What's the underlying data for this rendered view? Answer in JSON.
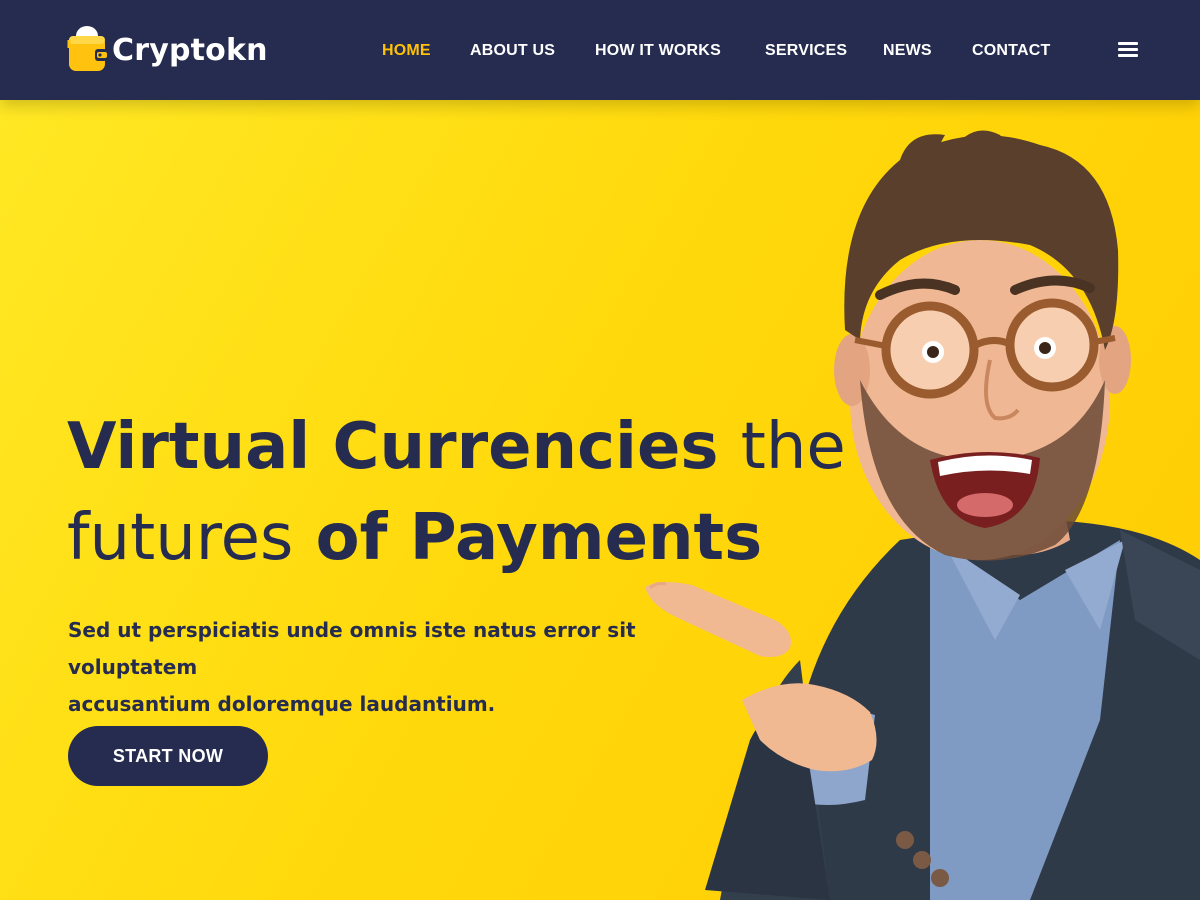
{
  "brand": {
    "name": "Cryptokn",
    "logo_icon": "wallet-coin-icon",
    "colors": {
      "primary": "#262c4f",
      "accent": "#ffc107",
      "hero_background": "#ffd80e"
    }
  },
  "nav": {
    "items": [
      {
        "label": "HOME",
        "active": true
      },
      {
        "label": "ABOUT US",
        "active": false
      },
      {
        "label": "HOW IT WORKS",
        "active": false
      },
      {
        "label": "SERVICES",
        "active": false
      },
      {
        "label": "NEWS",
        "active": false
      },
      {
        "label": "CONTACT",
        "active": false
      }
    ],
    "menu_icon": "hamburger-menu-icon"
  },
  "hero": {
    "headline": {
      "part1": "Virtual Currencies",
      "part2": "the",
      "part3": "futures",
      "part4": "of Payments"
    },
    "subtext_line1": "Sed ut perspiciatis unde omnis iste natus error sit voluptatem",
    "subtext_line2": "accusantium doloremque laudantium.",
    "cta_label": "START NOW",
    "image": "smiling-man-in-glasses-pointing-left"
  }
}
